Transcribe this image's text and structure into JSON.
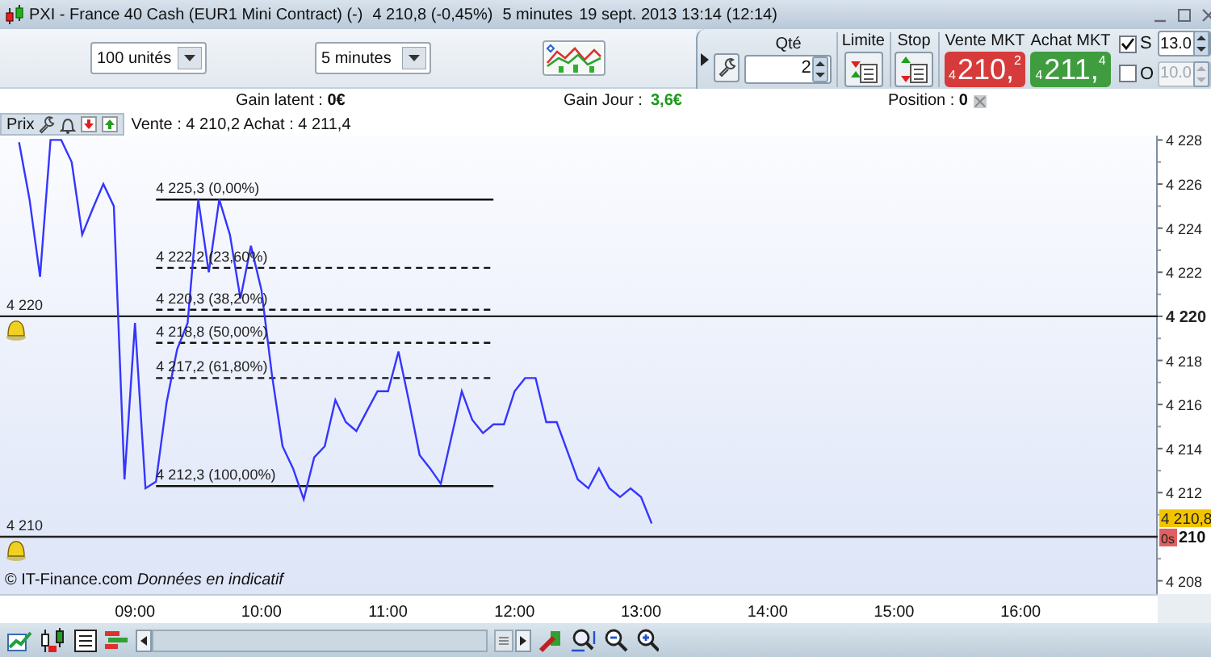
{
  "window": {
    "title": "PXI - France 40 Cash (EUR1 Mini Contract) (-)",
    "price": "4 210,8 (-0,45%)",
    "period": "5 minutes",
    "datetime": "19 sept. 2013 13:14 (12:14)"
  },
  "toolbar": {
    "quantity_select": "100 unités",
    "period_select": "5 minutes"
  },
  "order_panel": {
    "qty_label": "Qté",
    "qty_value": "2",
    "limit_label": "Limite",
    "stop_label": "Stop",
    "sell": {
      "label": "Vente MKT",
      "prefix": "4",
      "main": "210,",
      "suffix": "2"
    },
    "buy": {
      "label": "Achat MKT",
      "prefix": "4",
      "main": "211,",
      "suffix": "4"
    },
    "options": [
      {
        "label": "S",
        "checked": true,
        "value": "13.0",
        "disabled": false
      },
      {
        "label": "O",
        "checked": false,
        "value": "10.0",
        "disabled": true
      }
    ]
  },
  "info_bar": {
    "gain_latent": "Gain latent : **0€**",
    "gain_jour_label": "Gain Jour :",
    "gain_jour_value": "3,6€",
    "position": "Position : **0**"
  },
  "price_bar": {
    "label": "Prix",
    "quote": "Vente : 4 210,2 Achat : 4 211,4"
  },
  "chart": {
    "copyright": "© IT-Finance.com *Données en indicatif*",
    "chart_data": {
      "type": "line",
      "x": [
        485,
        490,
        495,
        500,
        505,
        510,
        515,
        520,
        525,
        530,
        535,
        540,
        545,
        550,
        555,
        560,
        565,
        570,
        575,
        580,
        585,
        590,
        595,
        600,
        605,
        610,
        615,
        620,
        625,
        630,
        635,
        640,
        645,
        650,
        655,
        660,
        665,
        670,
        675,
        680,
        685,
        690,
        695,
        700,
        705,
        710,
        715,
        720,
        725,
        730,
        735,
        740,
        745,
        750,
        755,
        760,
        765,
        770,
        775,
        780,
        785
      ],
      "series": [
        {
          "color": "#3535ff",
          "values": [
            4227.9,
            4225.3,
            4221.8,
            4228.0,
            4228.0,
            4227.0,
            4223.7,
            4224.9,
            4226.0,
            4225.0,
            4212.6,
            4219.7,
            4212.2,
            4212.5,
            4216.1,
            4218.5,
            4219.7,
            4225.3,
            4222.0,
            4225.3,
            4223.7,
            4220.8,
            4223.2,
            4221.2,
            4217.3,
            4214.1,
            4213.1,
            4211.7,
            4213.6,
            4214.1,
            4216.2,
            4215.2,
            4214.8,
            4215.7,
            4216.6,
            4216.6,
            4218.4,
            4216.1,
            4213.7,
            4213.1,
            4212.4,
            4214.5,
            4216.6,
            4215.3,
            4214.7,
            4215.1,
            4215.1,
            4216.6,
            4217.2,
            4217.2,
            4215.2,
            4215.2,
            4213.9,
            4212.6,
            4212.2,
            4213.1,
            4212.2,
            4211.8,
            4212.2,
            4211.8,
            4210.6
          ]
        }
      ],
      "xlim": [
        476,
        1025
      ],
      "ylim": [
        4207.4,
        4228.2
      ],
      "xticks": [
        {
          "value": 540,
          "label": "09:00"
        },
        {
          "value": 600,
          "label": "10:00"
        },
        {
          "value": 660,
          "label": "11:00"
        },
        {
          "value": 720,
          "label": "12:00"
        },
        {
          "value": 780,
          "label": "13:00"
        },
        {
          "value": 840,
          "label": "14:00"
        },
        {
          "value": 900,
          "label": "15:00"
        },
        {
          "value": 960,
          "label": "16:00"
        }
      ],
      "yticks": [
        {
          "value": 4208,
          "label": "4 208"
        },
        {
          "value": 4212,
          "label": "4 212"
        },
        {
          "value": 4214,
          "label": "4 214"
        },
        {
          "value": 4216,
          "label": "4 216"
        },
        {
          "value": 4218,
          "label": "4 218"
        },
        {
          "value": 4220,
          "label": "4 220"
        },
        {
          "value": 4222,
          "label": "4 222"
        },
        {
          "value": 4224,
          "label": "4 224"
        },
        {
          "value": 4226,
          "label": "4 226"
        },
        {
          "value": 4228,
          "label": "4 228"
        }
      ]
    },
    "fib_levels": [
      "4 225,3 (0,00%)",
      "4 222,2 (23,60%)",
      "4 220,3 (38,20%)",
      "4 218,8 (50,00%)",
      "4 217,2 (61,80%)",
      "4 212,3 (100,00%)"
    ],
    "alerts": [
      {
        "label": "4 220"
      },
      {
        "label": "4 210",
        "axis_label": "210",
        "badge": "0s"
      }
    ],
    "current_price": "4 210,8"
  }
}
